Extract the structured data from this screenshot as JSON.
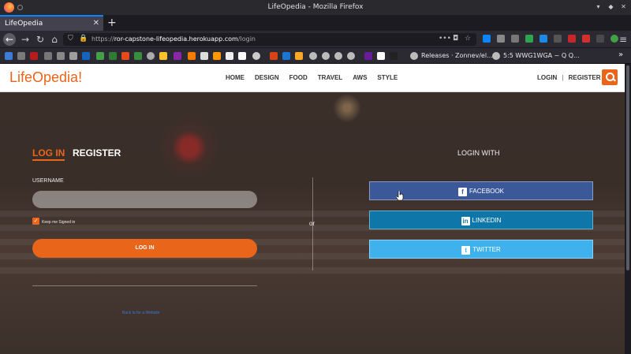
{
  "window": {
    "title": "LifeOpedia - Mozilla Firefox"
  },
  "tab": {
    "label": "LifeOpedia",
    "close": "✕",
    "new": "+"
  },
  "urlbar": {
    "prefix": "https://",
    "host": "ror-capstone-lifeopedia.herokuapp.com",
    "path": "/login"
  },
  "bookmarks": {
    "releases": "Releases · Zonnev/el...",
    "wwg": "5:5 WWG1WGA ~ Q Q..."
  },
  "site": {
    "logo": "LifeOpedia!",
    "menu": [
      "HOME",
      "DESIGN",
      "FOOD",
      "TRAVEL",
      "AWS",
      "STYLE"
    ],
    "login": "LOGIN",
    "sep": "|",
    "register": "REGISTER"
  },
  "form": {
    "tab_login": "LOG IN",
    "tab_register": "REGISTER",
    "username_label": "USERNAME",
    "username_value": "",
    "keep_signed_in": "Keep me Signed in",
    "login_button": "LOG IN",
    "back_link": "Back to for a Website"
  },
  "divider": {
    "or": "or"
  },
  "social": {
    "heading": "LOGIN WITH",
    "facebook": "FACEBOOK",
    "linkedin": "LINKEDIN",
    "twitter": "TWITTER"
  },
  "colors": {
    "accent": "#e8651a",
    "facebook": "#3b5998",
    "linkedin": "#0e76a8",
    "twitter": "#3fb2ee"
  }
}
